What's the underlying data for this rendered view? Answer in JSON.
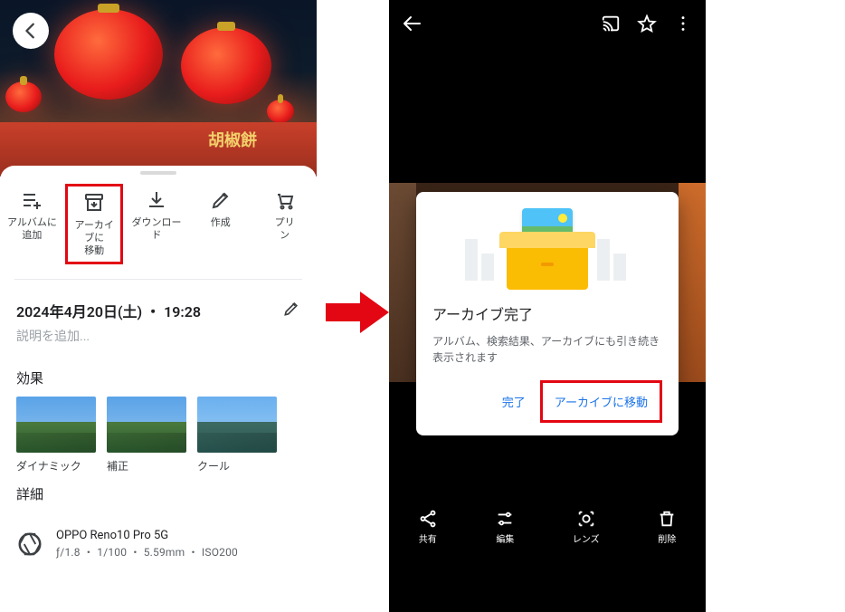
{
  "left": {
    "stall_sign": "胡椒餅",
    "actions": {
      "add_album": "アルバムに\n追加",
      "archive": "アーカイブに\n移動",
      "download": "ダウンロー\nド",
      "create": "作成",
      "print": "プリ\nン"
    },
    "date": "2024年4月20日(土) ・ 19:28",
    "description_placeholder": "説明を追加...",
    "sections": {
      "effects": "効果",
      "details": "詳細"
    },
    "effects": {
      "dynamic": "ダイナミック",
      "correction": "補正",
      "cool": "クール"
    },
    "device": {
      "name": "OPPO Reno10 Pro 5G",
      "meta": "ƒ/1.8 ・ 1/100 ・ 5.59mm ・ ISO200"
    }
  },
  "right": {
    "dialog": {
      "title": "アーカイブ完了",
      "body": "アルバム、検索結果、アーカイブにも引き続き表示されます",
      "done": "完了",
      "go_archive": "アーカイブに移動"
    },
    "bottom": {
      "share": "共有",
      "edit": "編集",
      "lens": "レンズ",
      "delete": "削除"
    }
  }
}
